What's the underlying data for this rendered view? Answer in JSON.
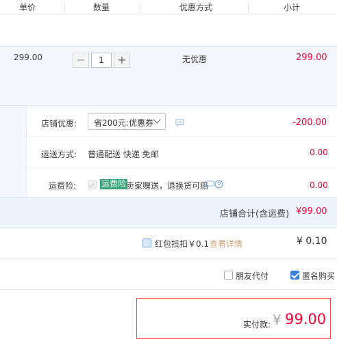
{
  "columns": {
    "unit_price": "单价",
    "quantity": "数量",
    "discount_method": "优惠方式",
    "subtotal": "小计"
  },
  "item": {
    "unit_price": "299.00",
    "quantity": "1",
    "discount": "无优惠",
    "subtotal": "299.00"
  },
  "shop": {
    "coupon_label": "店铺优惠:",
    "coupon_selected": "省200元:优惠券",
    "coupon_amount": "-200.00",
    "shipping_label": "运送方式:",
    "shipping_value": "普通配送 快递 免邮",
    "shipping_amount": "0.00",
    "insurance_label": "运费险:",
    "insurance_tag": "运费险",
    "insurance_desc": "卖家赠送，退换货可赔",
    "insurance_amount": "0.00",
    "total_label": "店铺合计(含运费)",
    "total_amount": "¥99.00"
  },
  "red_packet": {
    "label": "红包抵扣￥0.1",
    "link": "查看详情",
    "amount": "¥ 0.10"
  },
  "options": {
    "friend_pay": "朋友代付",
    "anonymous": "匿名购买",
    "anonymous_checked": true,
    "friend_pay_checked": false
  },
  "payment": {
    "label": "实付款:",
    "currency": "¥",
    "amount": "99.00"
  },
  "colors": {
    "accent_red": "#ff0036",
    "link_gold": "#c9a27c",
    "insurance_green": "#3aa57a",
    "checkbox_blue": "#3d7fe0"
  }
}
